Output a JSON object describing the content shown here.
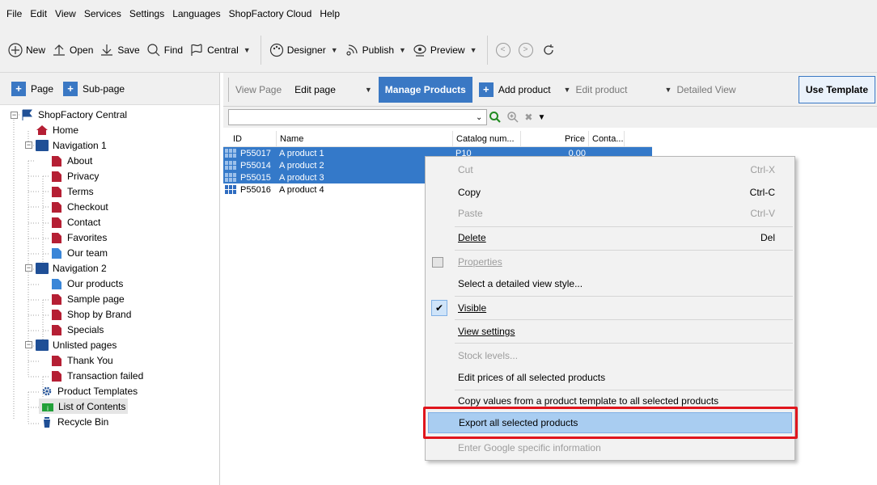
{
  "menubar": {
    "items": [
      "File",
      "Edit",
      "View",
      "Services",
      "Settings",
      "Languages",
      "ShopFactory Cloud",
      "Help"
    ]
  },
  "toolbar": {
    "new_label": "New",
    "open_label": "Open",
    "save_label": "Save",
    "find_label": "Find",
    "central_label": "Central",
    "designer_label": "Designer",
    "publish_label": "Publish",
    "preview_label": "Preview"
  },
  "leftpanel": {
    "page_label": "Page",
    "subpage_label": "Sub-page",
    "tree": [
      "ShopFactory Central",
      "Home",
      "Navigation 1",
      "About",
      "Privacy",
      "Terms",
      "Checkout",
      "Contact",
      "Favorites",
      "Our team",
      "Navigation 2",
      "Our products",
      "Sample page",
      "Shop by Brand",
      "Specials",
      "Unlisted pages",
      "Thank You",
      "Transaction failed",
      "Product Templates",
      "List of Contents",
      "Recycle Bin"
    ]
  },
  "tabs": {
    "view_page": "View Page",
    "edit_page": "Edit page",
    "manage_products": "Manage Products",
    "add_product": "Add product",
    "edit_product": "Edit product",
    "detailed_view": "Detailed View",
    "use_template": "Use Template"
  },
  "grid": {
    "headers": [
      "ID",
      "Name",
      "Catalog num...",
      "Price",
      "Conta..."
    ],
    "rows": [
      {
        "id": "P55017",
        "name": "A product 1",
        "catalog": "P10",
        "price": "0.00"
      },
      {
        "id": "P55014",
        "name": "A product 2"
      },
      {
        "id": "P55015",
        "name": "A product 3"
      },
      {
        "id": "P55016",
        "name": "A product 4"
      }
    ]
  },
  "context_menu": {
    "cut": "Cut",
    "cut_sc": "Ctrl-X",
    "copy": "Copy",
    "copy_sc": "Ctrl-C",
    "paste": "Paste",
    "paste_sc": "Ctrl-V",
    "delete": "Delete",
    "delete_sc": "Del",
    "properties": "Properties",
    "detailed_view_style": "Select a detailed view style...",
    "visible": "Visible",
    "view_settings": "View settings",
    "stock_levels": "Stock levels...",
    "edit_prices": "Edit prices of all selected products",
    "copy_values": "Copy values from a product template to all selected products",
    "export": "Export all selected products",
    "google": "Enter Google specific information"
  },
  "colors": {
    "accent": "#3a78c4",
    "selection": "#3479c9",
    "highlight_box": "#e0161d",
    "menu_hover": "#a9cdf1"
  }
}
